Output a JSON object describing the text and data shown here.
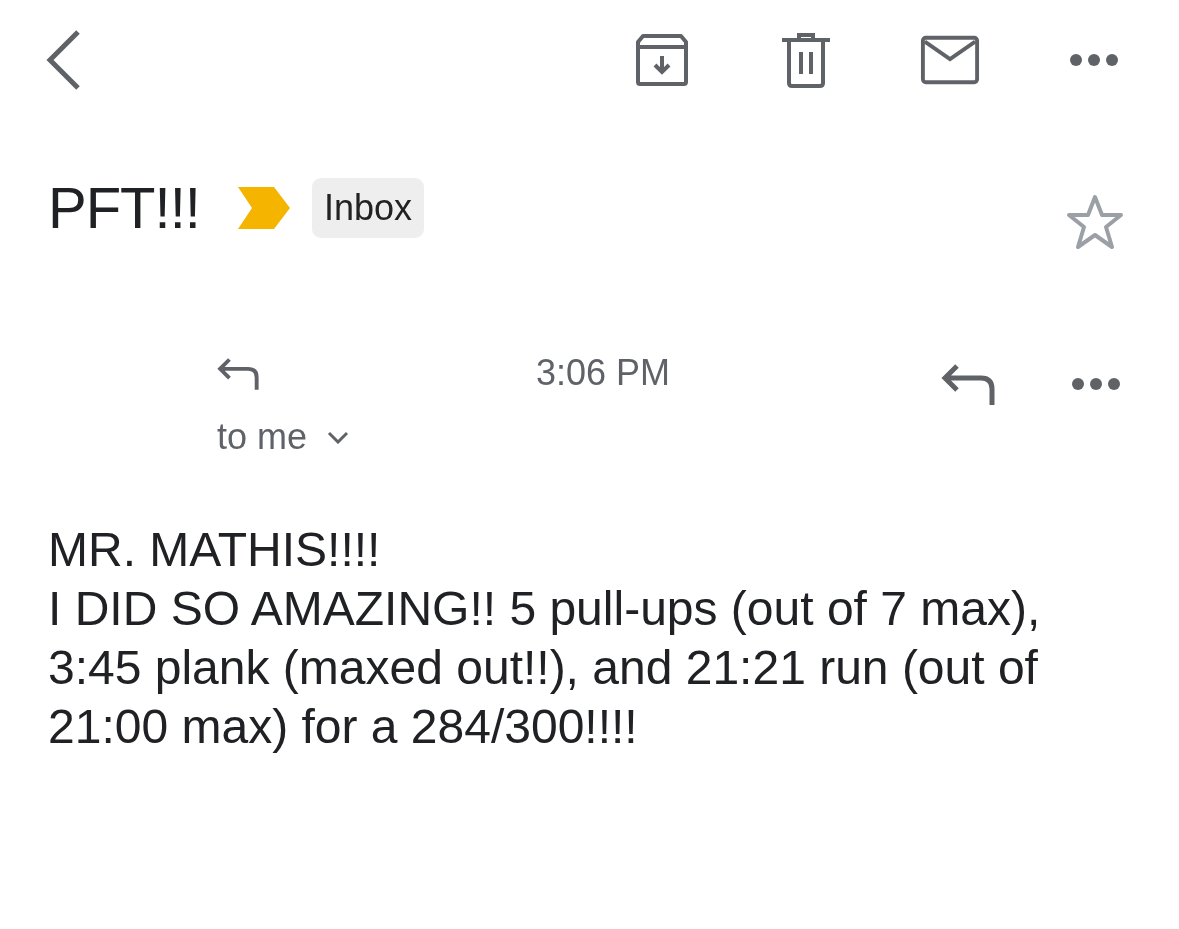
{
  "subject": {
    "title": "PFT!!!",
    "important": true,
    "label": "Inbox",
    "starred": false
  },
  "message": {
    "time": "3:06 PM",
    "recipient": "to me",
    "body": [
      "MR. MATHIS!!!!",
      "I DID SO AMAZING!! 5 pull-ups (out of 7 max), 3:45 plank (maxed out!!), and 21:21 run (out of 21:00 max) for a 284/300!!!!"
    ]
  }
}
